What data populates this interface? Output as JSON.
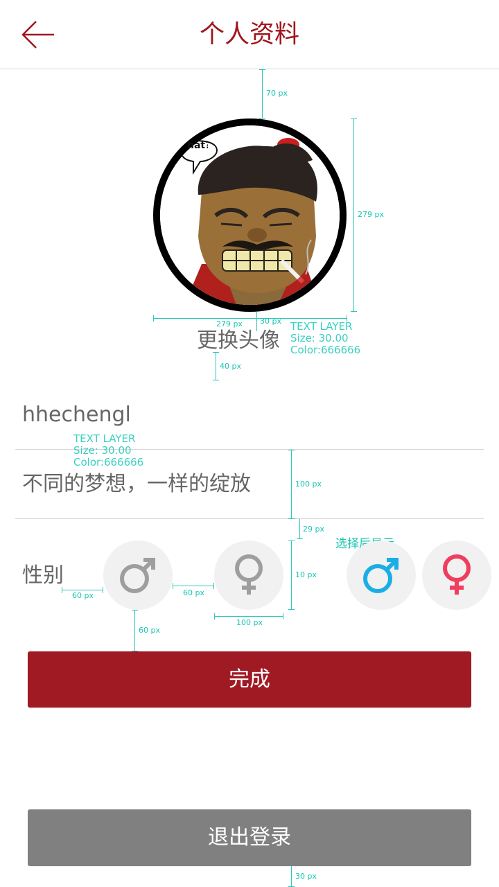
{
  "header": {
    "title": "个人资料",
    "back_icon": "back-arrow-icon"
  },
  "profile": {
    "change_avatar_label": "更换头像",
    "username": "hhechengl",
    "signature": "不同的梦想，一样的绽放",
    "gender_label": "性别",
    "selected_hint": "选择后显示"
  },
  "buttons": {
    "done_label": "完成",
    "logout_label": "退出登录"
  },
  "annotations": {
    "m70": "70 px",
    "m279_v": "279 px",
    "m279_h": "279 px",
    "m30_a": "30 px",
    "layer1": [
      "TEXT LAYER",
      "Size: 30.00",
      "Color:666666"
    ],
    "m40": "40 px",
    "layer2": [
      "TEXT LAYER",
      "Size: 30.00",
      "Color:666666"
    ],
    "m100_v": "100 px",
    "m29": "29 px",
    "m10": "10 px",
    "m60_a": "60 px",
    "m60_b": "60 px",
    "m100_h": "100 px",
    "m60_c": "60 px",
    "m30_b": "30 px"
  },
  "colors": {
    "accent": "#a01a24",
    "title": "#a0161e",
    "text": "#666666",
    "male_active": "#1aaee6",
    "female_active": "#ef3e5e",
    "inactive_icon": "#9e9e9e",
    "annotation": "#18c6b3"
  }
}
